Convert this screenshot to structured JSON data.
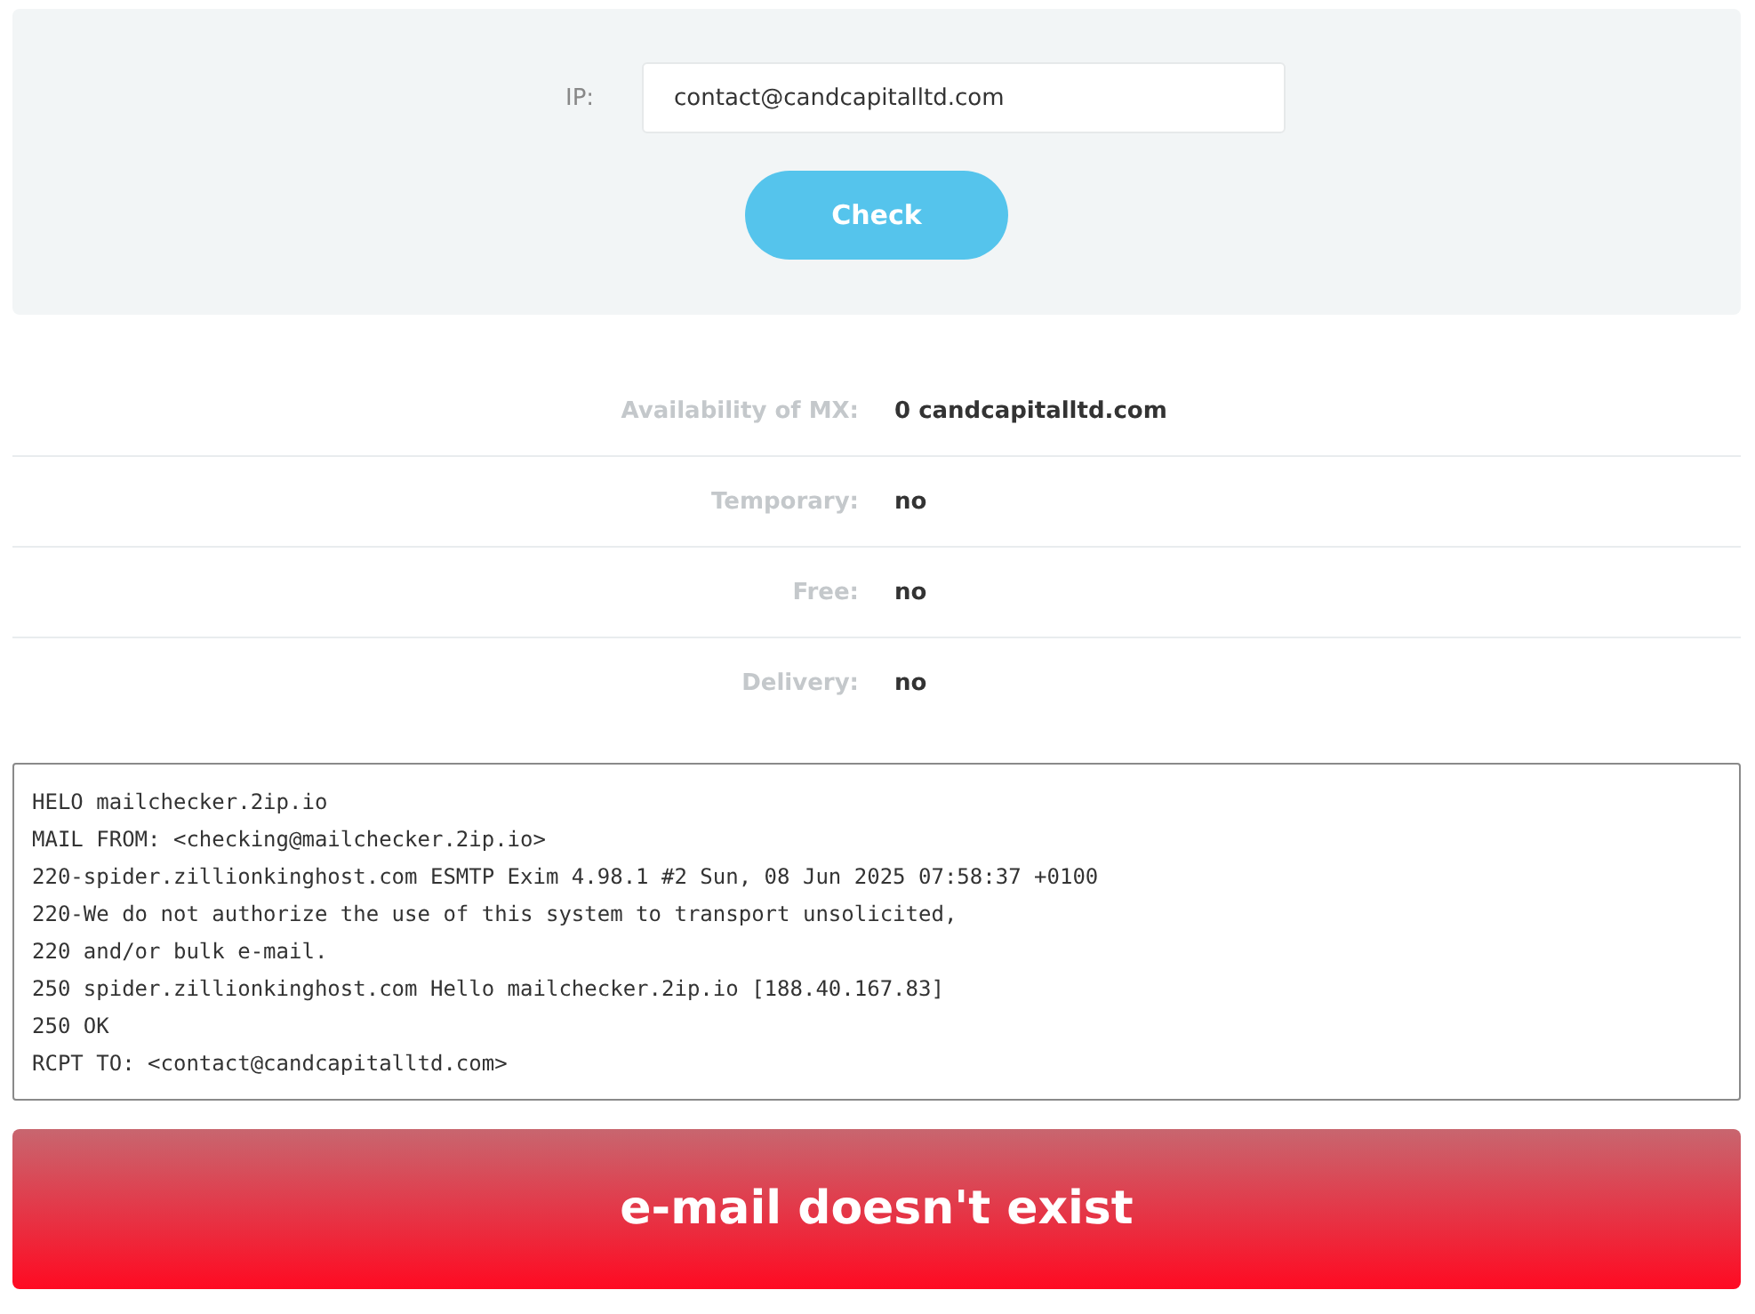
{
  "form": {
    "label": "IP:",
    "value": "contact@candcapitalltd.com",
    "button": "Check"
  },
  "results": [
    {
      "label": "Availability of MX:",
      "value": "0 candcapitalltd.com"
    },
    {
      "label": "Temporary:",
      "value": "no"
    },
    {
      "label": "Free:",
      "value": "no"
    },
    {
      "label": "Delivery:",
      "value": "no"
    }
  ],
  "log": [
    "HELO mailchecker.2ip.io",
    "MAIL FROM: <checking@mailchecker.2ip.io>",
    "220-spider.zillionkinghost.com ESMTP Exim 4.98.1 #2 Sun, 08 Jun 2025 07:58:37 +0100",
    "220-We do not authorize the use of this system to transport unsolicited,",
    "220 and/or bulk e-mail.",
    "250 spider.zillionkinghost.com Hello mailchecker.2ip.io [188.40.167.83]",
    "250 OK",
    "RCPT TO: <contact@candcapitalltd.com>"
  ],
  "verdict": {
    "kind": "error",
    "text": "e-mail doesn't exist"
  }
}
